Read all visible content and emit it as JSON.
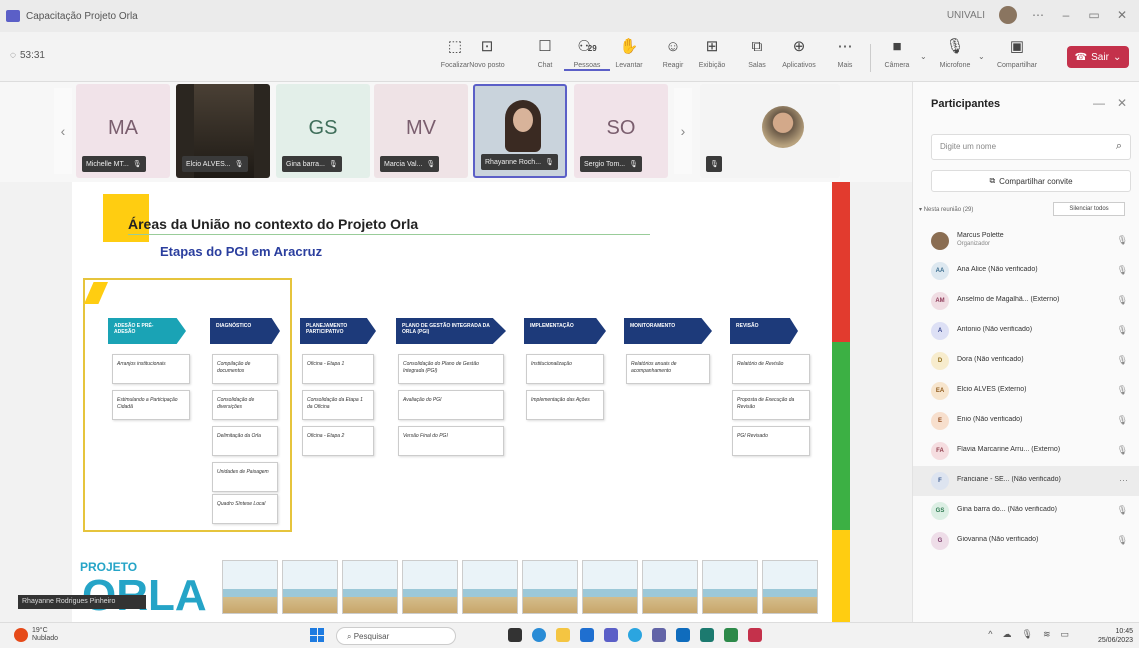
{
  "window": {
    "title": "Capacitação Projeto Orla",
    "org": "UNIVALI"
  },
  "toolbar": {
    "timer": "53:31",
    "tools": [
      {
        "label": "Focalizar",
        "icon": "⬚"
      },
      {
        "label": "Novo posto",
        "icon": "⊡"
      },
      {
        "label": "Chat",
        "icon": "☐"
      },
      {
        "label": "Pessoas",
        "icon": "⚇",
        "count": "29"
      },
      {
        "label": "Levantar",
        "icon": "✋"
      },
      {
        "label": "Reagir",
        "icon": "☺"
      },
      {
        "label": "Exibição",
        "icon": "⊞"
      },
      {
        "label": "Salas",
        "icon": "⧉"
      },
      {
        "label": "Aplicativos",
        "icon": "⊕"
      },
      {
        "label": "Mais",
        "icon": "⋯"
      }
    ],
    "camera": "Câmera",
    "mic": "Microfone",
    "share": "Compartilhar",
    "leave": "Sair"
  },
  "gallery": {
    "tiles": [
      {
        "initials": "MA",
        "name": "Michelle MT...",
        "bg": "#f1e3e9"
      },
      {
        "initials": "",
        "name": "Elcio ALVES...",
        "bg": "#2b2620"
      },
      {
        "initials": "GS",
        "name": "Gina barra...",
        "bg": "#e3efe9"
      },
      {
        "initials": "MV",
        "name": "Marcia Val...",
        "bg": "#efe3e6"
      },
      {
        "initials": "",
        "name": "Rhayanne Roch...",
        "bg": "#c9d3dc"
      },
      {
        "initials": "SO",
        "name": "Sergio Tom...",
        "bg": "#f1e3e9"
      }
    ]
  },
  "slide": {
    "title": "Áreas da União no contexto do Projeto Orla",
    "subtitle": "Etapas do PGI em Aracruz",
    "phases": [
      {
        "label": "ADESÃO E PRÉ-ADESÃO",
        "cells": [
          "Arranjos institucionais",
          "Estimulando a Participação Cidadã"
        ]
      },
      {
        "label": "DIAGNÓSTICO",
        "cells": [
          "Compilação de documentos",
          "Consolidação de diversições",
          "Delimitação da Orla",
          "Unidades de Paisagem",
          "Quadro Síntese Local"
        ]
      },
      {
        "label": "PLANEJAMENTO PARTICIPATIVO",
        "cells": [
          "Oficina - Etapa 1",
          "Consolidação da Etapa 1 da Oficina",
          "Oficina - Etapa 2"
        ]
      },
      {
        "label": "PLANO DE GESTÃO INTEGRADA DA ORLA (PGI)",
        "cells": [
          "Consolidação do Plano de Gestão Integrada (PGI)",
          "Avaliação do PGI",
          "Versão Final do PGI"
        ]
      },
      {
        "label": "IMPLEMENTAÇÃO",
        "cells": [
          "Institucionalização",
          "Implementação das Ações"
        ]
      },
      {
        "label": "MONITORAMENTO",
        "cells": [
          "Relatórios anuais de acompanhamento"
        ]
      },
      {
        "label": "REVISÃO",
        "cells": [
          "Relatório de Revisão",
          "Proposta de Execução da Revisão",
          "PGI Revisado"
        ]
      }
    ],
    "logo_top": "PROJETO",
    "logo_main": "ORLA",
    "speaker": "Rhayanne Rodrigues Pinheiro"
  },
  "panel": {
    "title": "Participantes",
    "search_placeholder": "Digite um nome",
    "share_invite": "Compartilhar convite",
    "section": "Nesta reunião (29)",
    "mute_all": "Silenciar todos",
    "participants": [
      {
        "initials": "",
        "name": "Marcus Polette",
        "role": "Organizador",
        "color": "#8a6d52",
        "fg": "#fff"
      },
      {
        "initials": "AA",
        "name": "Ana Alice (Não verificado)",
        "role": "",
        "color": "#dde8f0",
        "fg": "#3c6e8f"
      },
      {
        "initials": "AM",
        "name": "Anselmo de Magalhã... (Externo)",
        "role": "",
        "color": "#f0dde3",
        "fg": "#8f3c5a"
      },
      {
        "initials": "A",
        "name": "Antonio (Não verificado)",
        "role": "",
        "color": "#dde0f5",
        "fg": "#3c4a8f"
      },
      {
        "initials": "D",
        "name": "Dora (Não verificado)",
        "role": "",
        "color": "#f7eccd",
        "fg": "#8f6d1c"
      },
      {
        "initials": "EA",
        "name": "Elcio ALVES (Externo)",
        "role": "",
        "color": "#f7e5cd",
        "fg": "#8f5a1c"
      },
      {
        "initials": "E",
        "name": "Enio (Não verificado)",
        "role": "",
        "color": "#f7dfcd",
        "fg": "#8f4a1c"
      },
      {
        "initials": "FA",
        "name": "Flavia Marcarine Arru... (Externo)",
        "role": "",
        "color": "#f5dde0",
        "fg": "#8f3c4a"
      },
      {
        "initials": "F",
        "name": "Franciane - SE... (Não verificado)",
        "role": "",
        "color": "#dde4f0",
        "fg": "#3c5a8f"
      },
      {
        "initials": "GS",
        "name": "Gina barra do... (Não verificado)",
        "role": "",
        "color": "#dcefe4",
        "fg": "#2f7a52"
      },
      {
        "initials": "G",
        "name": "Giovanna (Não verificado)",
        "role": "",
        "color": "#eedde8",
        "fg": "#7a3c6a"
      }
    ]
  },
  "taskbar": {
    "weather_temp": "19°C",
    "weather_desc": "Nublado",
    "search": "Pesquisar",
    "time": "10:45",
    "date": "25/06/2023"
  }
}
